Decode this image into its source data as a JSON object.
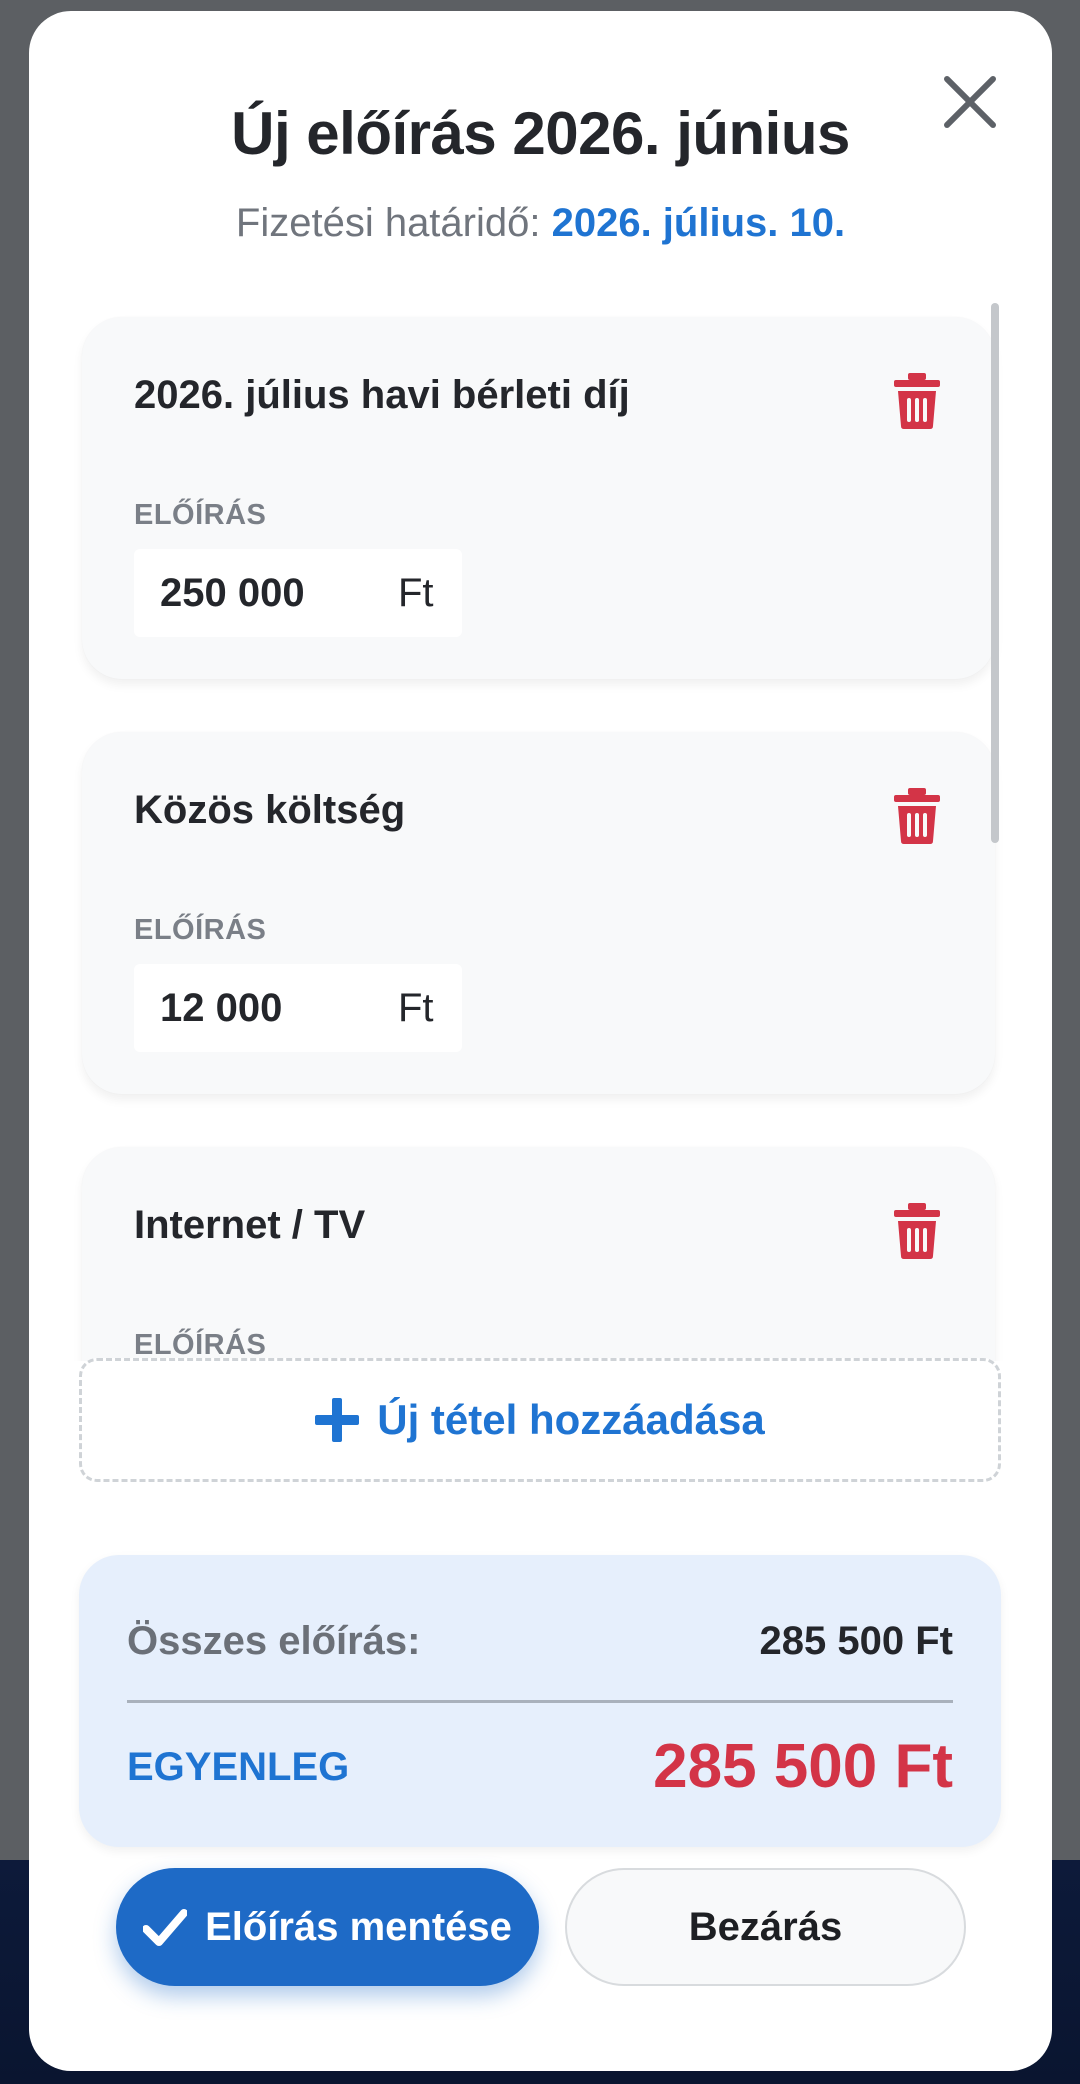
{
  "modal": {
    "title": "Új előírás 2026. június",
    "due_prefix": "Fizetési határidő: ",
    "due_date": "2026. július. 10."
  },
  "items": [
    {
      "title": "2026. július havi bérleti díj",
      "field_label": "ELŐÍRÁS",
      "amount": "250 000",
      "unit": "Ft"
    },
    {
      "title": "Közös költség",
      "field_label": "ELŐÍRÁS",
      "amount": "12 000",
      "unit": "Ft"
    },
    {
      "title": "Internet / TV",
      "field_label": "ELŐÍRÁS"
    }
  ],
  "add_item_label": "Új tétel hozzáadása",
  "summary": {
    "total_label": "Összes előírás:",
    "total_value": "285 500 Ft",
    "balance_label": "EGYENLEG",
    "balance_value": "285 500 Ft"
  },
  "actions": {
    "save_label": "Előírás mentése",
    "close_label": "Bezárás"
  },
  "icons": {
    "close": "close-icon",
    "delete": "trash-icon",
    "add": "plus-icon",
    "save": "check-icon"
  },
  "colors": {
    "accent_blue": "#1f74d2",
    "danger_red": "#d33447",
    "summary_bg": "#e6effc"
  }
}
